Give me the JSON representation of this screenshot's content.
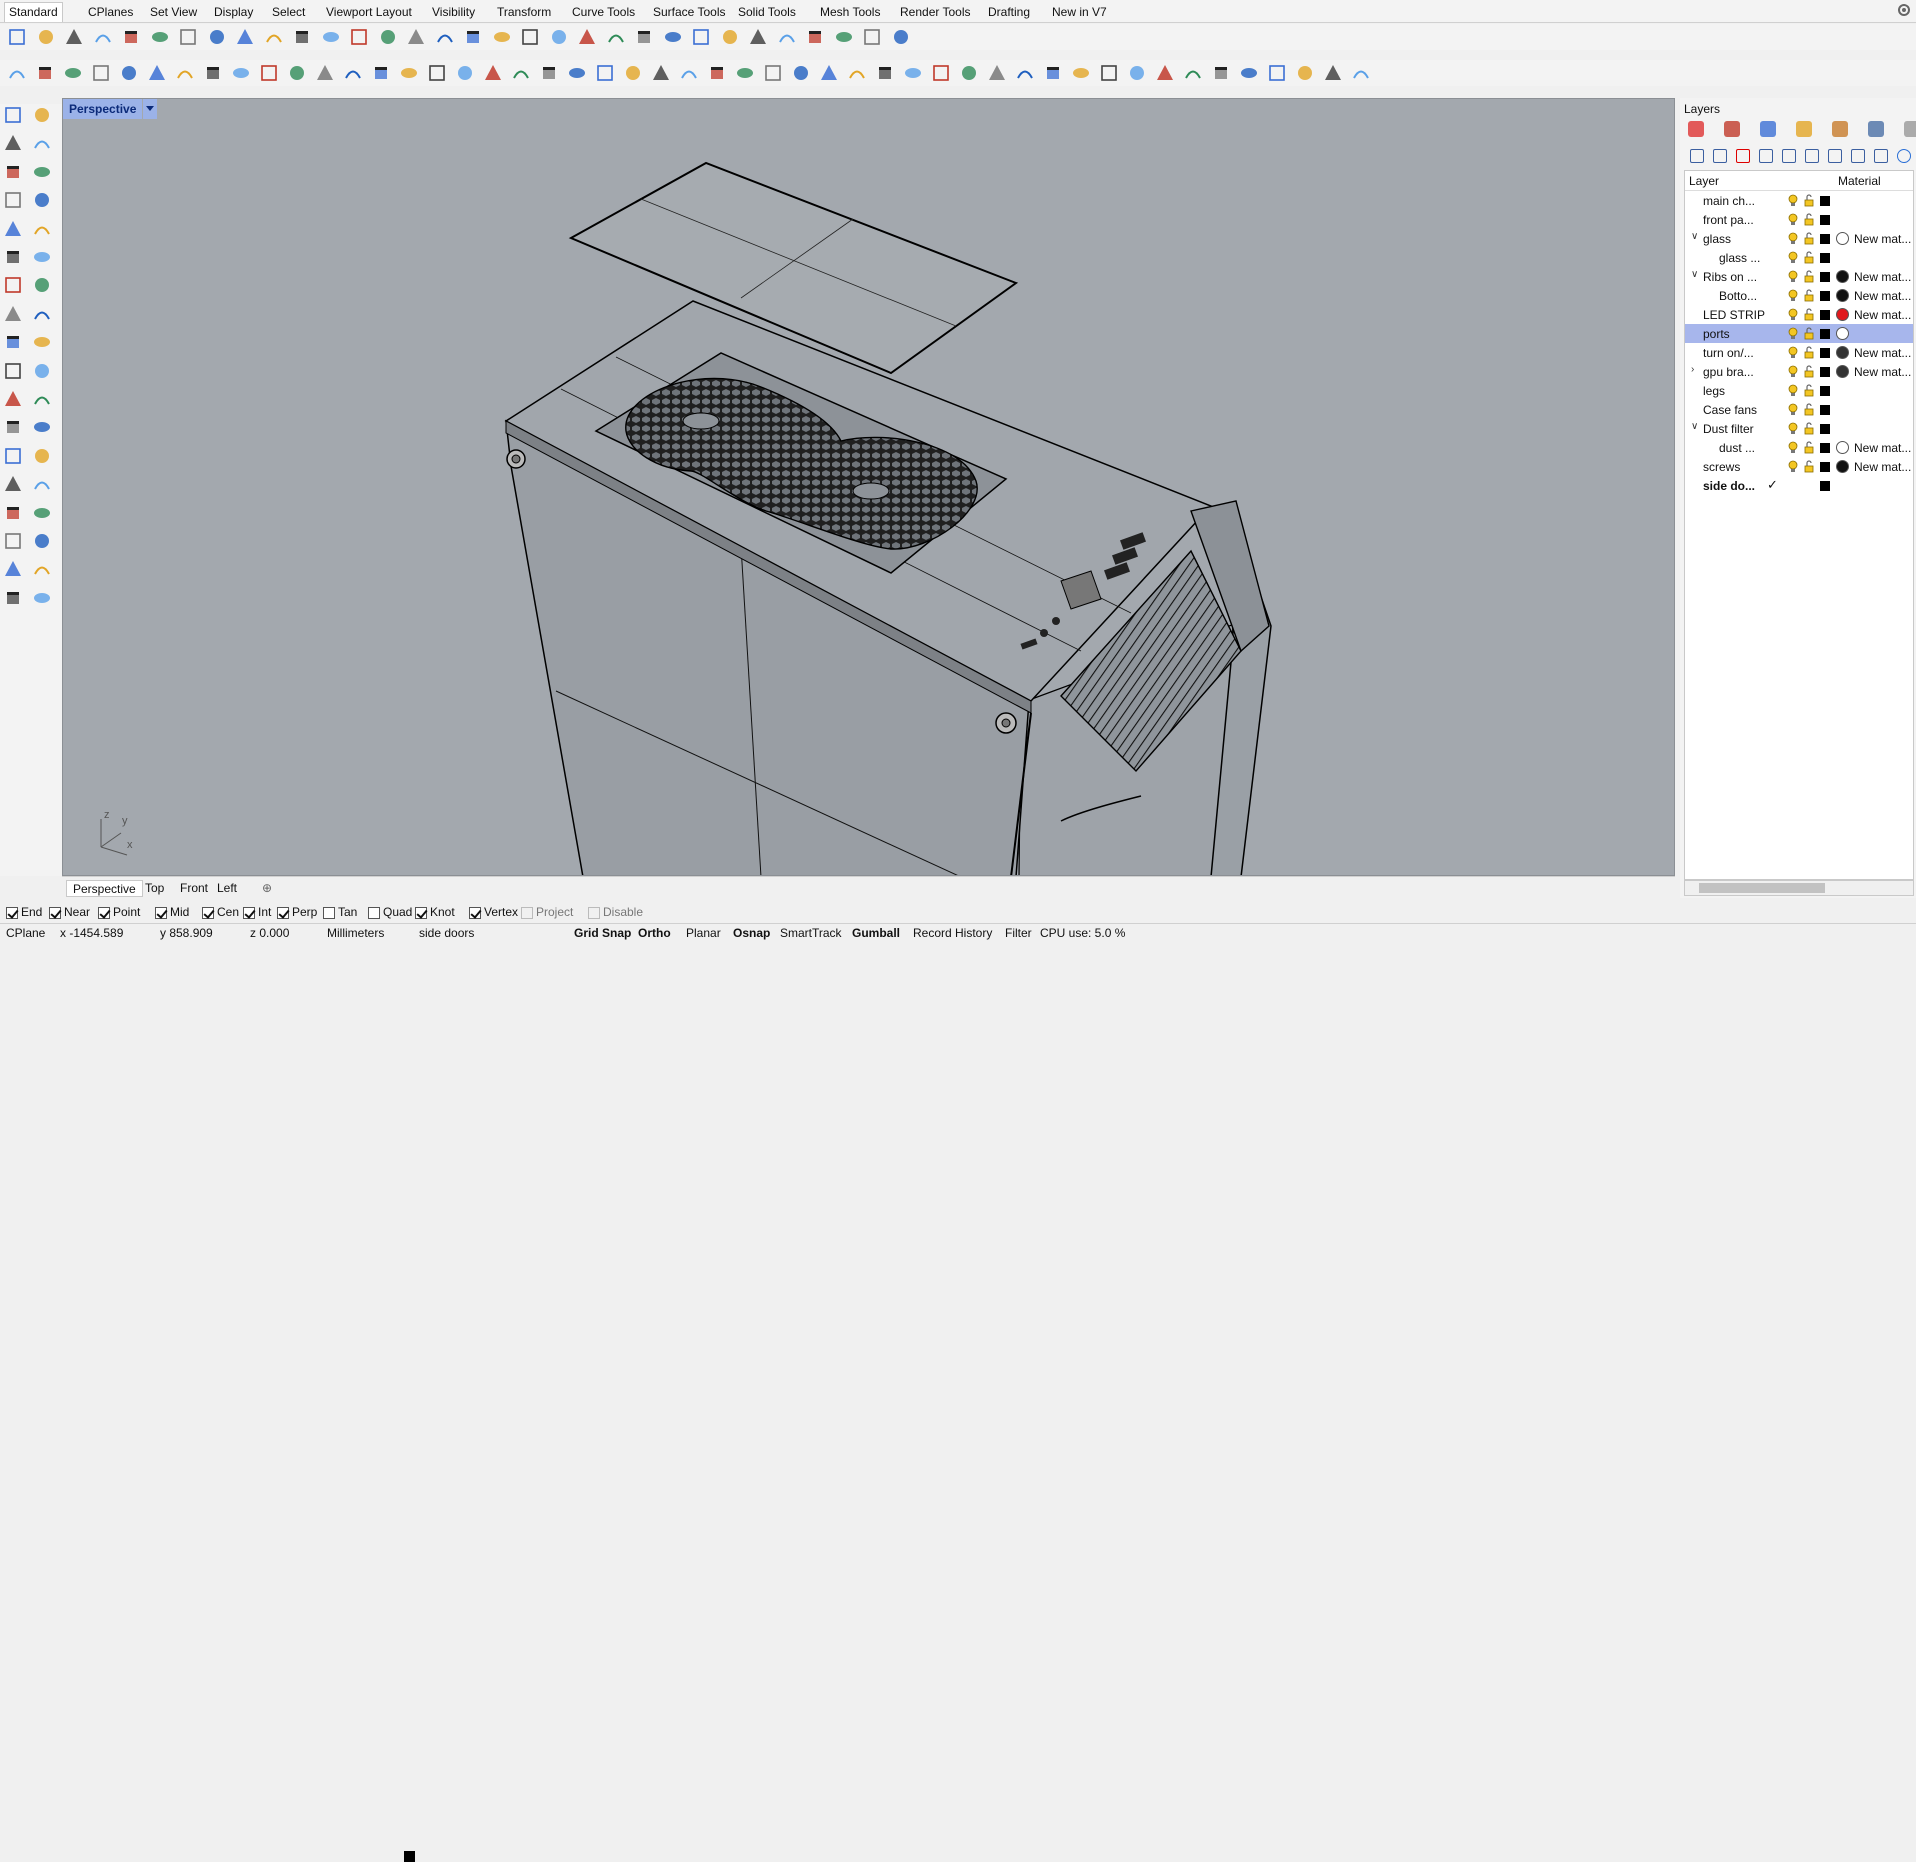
{
  "menu_tabs": [
    "Standard",
    "CPlanes",
    "Set View",
    "Display",
    "Select",
    "Viewport Layout",
    "Visibility",
    "Transform",
    "Curve Tools",
    "Surface Tools",
    "Solid Tools",
    "Mesh Tools",
    "Render Tools",
    "Drafting",
    "New in V7"
  ],
  "active_tab": "Standard",
  "viewport": {
    "title": "Perspective",
    "axis_labels": {
      "z": "z",
      "y": "y",
      "x": "x"
    }
  },
  "viewport_tabs": [
    "Perspective",
    "Top",
    "Front",
    "Left"
  ],
  "active_viewport_tab": "Perspective",
  "osnaps": [
    {
      "label": "End",
      "checked": true,
      "enabled": true
    },
    {
      "label": "Near",
      "checked": true,
      "enabled": true
    },
    {
      "label": "Point",
      "checked": true,
      "enabled": true
    },
    {
      "label": "Mid",
      "checked": true,
      "enabled": true
    },
    {
      "label": "Cen",
      "checked": true,
      "enabled": true
    },
    {
      "label": "Int",
      "checked": true,
      "enabled": true
    },
    {
      "label": "Perp",
      "checked": true,
      "enabled": true
    },
    {
      "label": "Tan",
      "checked": false,
      "enabled": true
    },
    {
      "label": "Quad",
      "checked": false,
      "enabled": true
    },
    {
      "label": "Knot",
      "checked": true,
      "enabled": true
    },
    {
      "label": "Vertex",
      "checked": true,
      "enabled": true
    },
    {
      "label": "Project",
      "checked": false,
      "enabled": false
    },
    {
      "label": "Disable",
      "checked": false,
      "enabled": false
    }
  ],
  "status": {
    "cplane": "CPlane",
    "x": "x -1454.589",
    "y": "y 858.909",
    "z": "z 0.000",
    "units": "Millimeters",
    "current_layer": "side doors",
    "grid_snap": "Grid Snap",
    "ortho": "Ortho",
    "planar": "Planar",
    "osnap": "Osnap",
    "smarttrack": "SmartTrack",
    "gumball": "Gumball",
    "record_history": "Record History",
    "filter": "Filter",
    "cpu": "CPU use: 5.0 %"
  },
  "layers_panel": {
    "title": "Layers",
    "col_layer": "Layer",
    "col_material": "Material",
    "rows": [
      {
        "name": "main ch...",
        "indent": 0,
        "expander": "",
        "color": "#000000",
        "mat_color": "",
        "mat_name": "",
        "selected": false,
        "current": false
      },
      {
        "name": "front pa...",
        "indent": 0,
        "expander": "",
        "color": "#000000",
        "mat_color": "",
        "mat_name": "",
        "selected": false,
        "current": false
      },
      {
        "name": "glass",
        "indent": 0,
        "expander": "v",
        "color": "#000000",
        "mat_color": "#ffffff",
        "mat_name": "New mat...",
        "selected": false,
        "current": false
      },
      {
        "name": "glass ...",
        "indent": 1,
        "expander": "",
        "color": "#000000",
        "mat_color": "",
        "mat_name": "",
        "selected": false,
        "current": false
      },
      {
        "name": "Ribs on ...",
        "indent": 0,
        "expander": "v",
        "color": "#000000",
        "mat_color": "#111111",
        "mat_name": "New mat...",
        "selected": false,
        "current": false
      },
      {
        "name": "Botto...",
        "indent": 1,
        "expander": "",
        "color": "#000000",
        "mat_color": "#111111",
        "mat_name": "New mat...",
        "selected": false,
        "current": false
      },
      {
        "name": "LED STRIP",
        "indent": 0,
        "expander": "",
        "color": "#000000",
        "mat_color": "#e0191d",
        "mat_name": "New mat...",
        "selected": false,
        "current": false
      },
      {
        "name": "ports",
        "indent": 0,
        "expander": "",
        "color": "#000000",
        "mat_color": "#ffffff",
        "mat_name": "",
        "selected": true,
        "current": false
      },
      {
        "name": "turn on/...",
        "indent": 0,
        "expander": "",
        "color": "#000000",
        "mat_color": "#333333",
        "mat_name": "New mat...",
        "selected": false,
        "current": false
      },
      {
        "name": "gpu bra...",
        "indent": 0,
        "expander": ">",
        "color": "#000000",
        "mat_color": "#333333",
        "mat_name": "New mat...",
        "selected": false,
        "current": false
      },
      {
        "name": "legs",
        "indent": 0,
        "expander": "",
        "color": "#000000",
        "mat_color": "",
        "mat_name": "",
        "selected": false,
        "current": false
      },
      {
        "name": "Case fans",
        "indent": 0,
        "expander": "",
        "color": "#000000",
        "mat_color": "",
        "mat_name": "",
        "selected": false,
        "current": false
      },
      {
        "name": "Dust filter",
        "indent": 0,
        "expander": "v",
        "color": "#000000",
        "mat_color": "",
        "mat_name": "",
        "selected": false,
        "current": false
      },
      {
        "name": "dust ...",
        "indent": 1,
        "expander": "",
        "color": "#000000",
        "mat_color": "#ffffff",
        "mat_name": "New mat...",
        "selected": false,
        "current": false
      },
      {
        "name": "screws",
        "indent": 0,
        "expander": "",
        "color": "#000000",
        "mat_color": "#111111",
        "mat_name": "New mat...",
        "selected": false,
        "current": false
      },
      {
        "name": "side do...",
        "indent": 0,
        "expander": "",
        "color": "#000000",
        "mat_color": "",
        "mat_name": "",
        "selected": false,
        "current": true
      }
    ]
  }
}
